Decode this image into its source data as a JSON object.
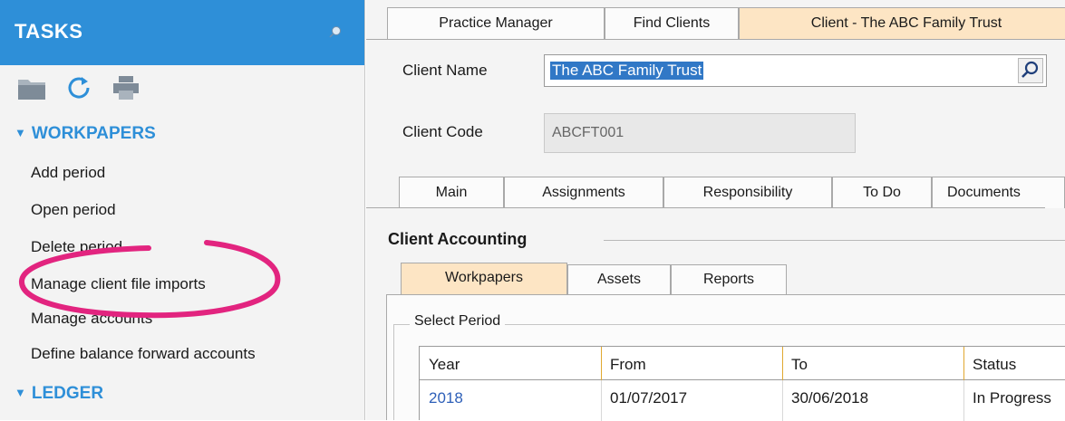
{
  "tasks": {
    "title": "TASKS",
    "sections": {
      "workpapers": "WORKPAPERS",
      "ledger": "LEDGER"
    },
    "workpaper_items": [
      "Add period",
      "Open period",
      "Delete period",
      "Manage client file imports",
      "Manage accounts",
      "Define balance forward accounts"
    ]
  },
  "colors": {
    "header_blue": "#2e8fd8",
    "active_tab": "#fde5c4",
    "highlight_oval": "#e2247f",
    "selection_blue": "#3178c6"
  },
  "doc_tabs": [
    "Practice Manager",
    "Find Clients",
    "Client - The ABC Family Trust"
  ],
  "client": {
    "name_label": "Client Name",
    "name_value": "The ABC Family Trust",
    "code_label": "Client Code",
    "code_value": "ABCFT001"
  },
  "sub_tabs": [
    "Main",
    "Assignments",
    "Responsibility",
    "To Do",
    "Documents"
  ],
  "accounting": {
    "title": "Client Accounting",
    "tabs": [
      "Workpapers",
      "Assets",
      "Reports"
    ],
    "select_period_label": "Select Period",
    "columns": [
      "Year",
      "From",
      "To",
      "Status"
    ],
    "rows": [
      {
        "year": "2018",
        "from": "01/07/2017",
        "to": "30/06/2018",
        "status": "In Progress"
      }
    ]
  }
}
